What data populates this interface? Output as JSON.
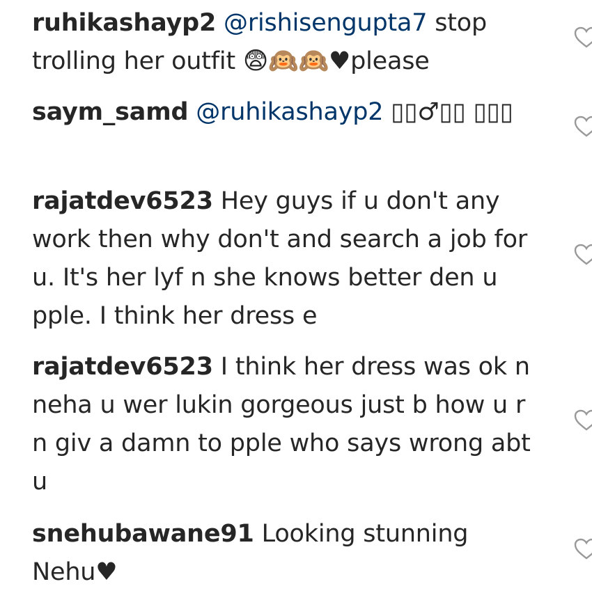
{
  "comments": [
    {
      "username": "ruhikashayp2",
      "mention": "@rishisengupta7",
      "text": " stop trolling her outfit 😨🙉🙉♥please"
    },
    {
      "username": "saym_samd",
      "mention": "@ruhikashayp2",
      "text": " ▯▯♂▯▯ ▯▯▯"
    },
    {
      "username": "rajatdev6523",
      "mention": "",
      "text": " Hey guys if u don't any work then why don't and search a job for u. It's her lyf n she knows better den u pple. I think her dress e"
    },
    {
      "username": "rajatdev6523",
      "mention": "",
      "text": " I think her dress was ok n neha u wer lukin gorgeous just b how u r n giv a damn to pple who says wrong abt u"
    },
    {
      "username": "snehubawane91",
      "mention": "",
      "text": " Looking stunning Nehu♥"
    }
  ],
  "icons": {
    "like": "heart-outline-icon"
  },
  "colors": {
    "text": "#262626",
    "mention": "#003569",
    "icon": "#999999"
  }
}
